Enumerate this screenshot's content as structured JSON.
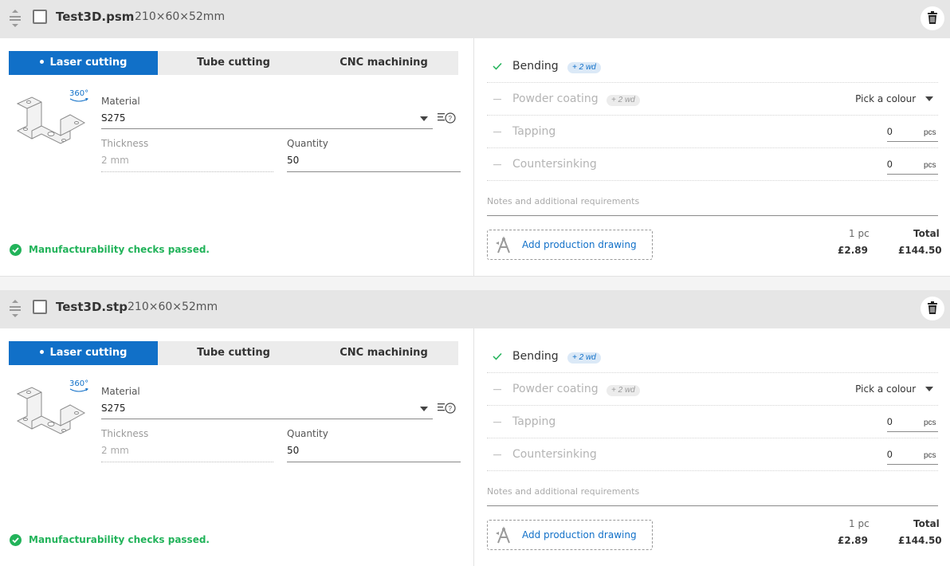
{
  "parts": [
    {
      "filename": "Test3D.psm",
      "dimensions": "210×60×52mm",
      "tabs": [
        {
          "label": "Laser cutting",
          "active": true
        },
        {
          "label": "Tube cutting",
          "active": false
        },
        {
          "label": "CNC machining",
          "active": false
        }
      ],
      "rotate_label": "360°",
      "material": {
        "label": "Material",
        "value": "S275"
      },
      "thickness": {
        "label": "Thickness",
        "value": "2 mm"
      },
      "quantity": {
        "label": "Quantity",
        "value": "50"
      },
      "check_status": "Manufacturability checks passed.",
      "operations": [
        {
          "label": "Bending",
          "enabled": true,
          "badge": "+ 2 wd"
        },
        {
          "label": "Powder coating",
          "enabled": false,
          "badge": "+ 2 wd",
          "select": "Pick a colour"
        },
        {
          "label": "Tapping",
          "enabled": false,
          "value": "0",
          "unit": "pcs"
        },
        {
          "label": "Countersinking",
          "enabled": false,
          "value": "0",
          "unit": "pcs"
        }
      ],
      "notes_placeholder": "Notes and additional requirements",
      "add_drawing_label": "Add production drawing",
      "unit_price_label": "1 pc",
      "unit_price": "£2.89",
      "total_label": "Total",
      "total": "£144.50"
    },
    {
      "filename": "Test3D.stp",
      "dimensions": "210×60×52mm",
      "tabs": [
        {
          "label": "Laser cutting",
          "active": true
        },
        {
          "label": "Tube cutting",
          "active": false
        },
        {
          "label": "CNC machining",
          "active": false
        }
      ],
      "rotate_label": "360°",
      "material": {
        "label": "Material",
        "value": "S275"
      },
      "thickness": {
        "label": "Thickness",
        "value": "2 mm"
      },
      "quantity": {
        "label": "Quantity",
        "value": "50"
      },
      "check_status": "Manufacturability checks passed.",
      "operations": [
        {
          "label": "Bending",
          "enabled": true,
          "badge": "+ 2 wd"
        },
        {
          "label": "Powder coating",
          "enabled": false,
          "badge": "+ 2 wd",
          "select": "Pick a colour"
        },
        {
          "label": "Tapping",
          "enabled": false,
          "value": "0",
          "unit": "pcs"
        },
        {
          "label": "Countersinking",
          "enabled": false,
          "value": "0",
          "unit": "pcs"
        }
      ],
      "notes_placeholder": "Notes and additional requirements",
      "add_drawing_label": "Add production drawing",
      "unit_price_label": "1 pc",
      "unit_price": "£2.89",
      "total_label": "Total",
      "total": "£144.50"
    }
  ],
  "colors": {
    "accent": "#1170c8",
    "success": "#22b35a",
    "header_bg": "#e6e6e6"
  },
  "icons": [
    "drag-handle-icon",
    "trash-icon",
    "rotate-360-icon",
    "material-info-icon",
    "check-icon",
    "dash-icon",
    "drawing-icon"
  ]
}
